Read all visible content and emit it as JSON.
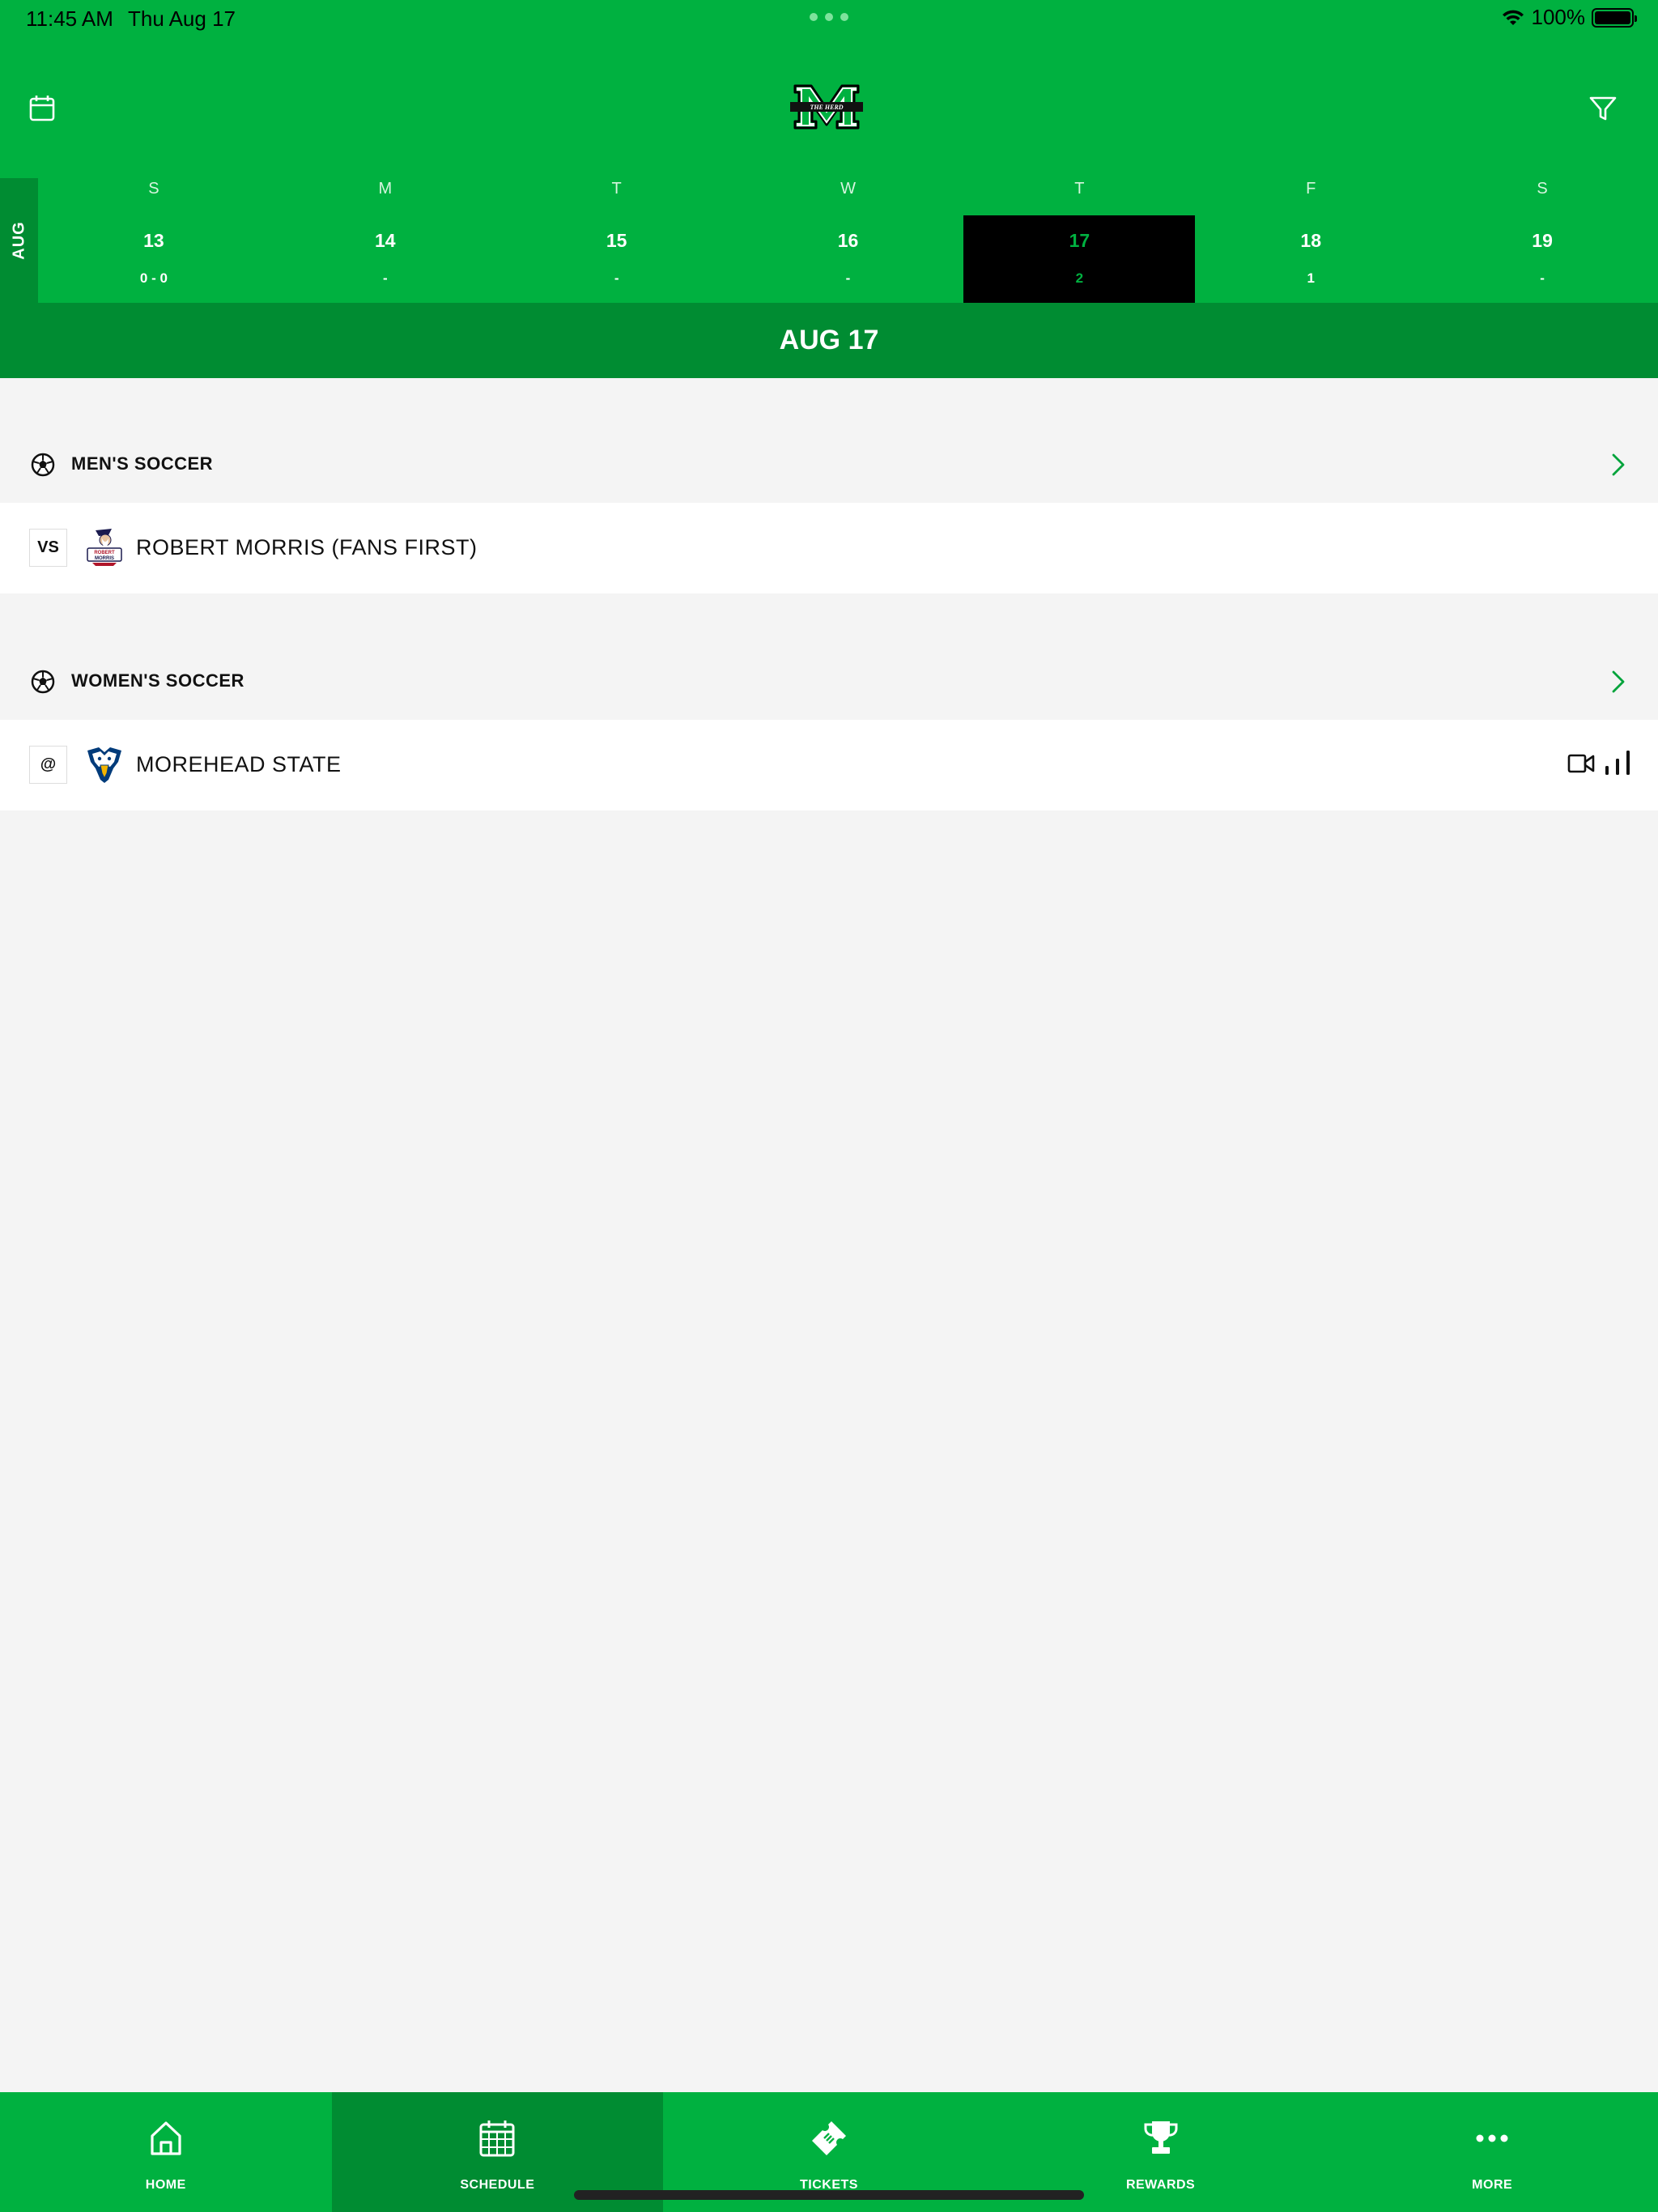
{
  "status_bar": {
    "time": "11:45 AM",
    "date": "Thu Aug 17",
    "battery": "100%"
  },
  "header": {
    "logo_icon": "marshall-thundering-herd-logo",
    "calendar_icon": "calendar-icon",
    "filter_icon": "filter-icon"
  },
  "week": {
    "month": "AUG",
    "days": [
      {
        "dow": "S",
        "num": "13",
        "count": "0 - 0"
      },
      {
        "dow": "M",
        "num": "14",
        "count": "-"
      },
      {
        "dow": "T",
        "num": "15",
        "count": "-"
      },
      {
        "dow": "W",
        "num": "16",
        "count": "-"
      },
      {
        "dow": "T",
        "num": "17",
        "count": "2"
      },
      {
        "dow": "F",
        "num": "18",
        "count": "1"
      },
      {
        "dow": "S",
        "num": "19",
        "count": "-"
      }
    ],
    "selected_index": 4
  },
  "selected_date": "AUG 17",
  "sections": [
    {
      "sport": "MEN'S SOCCER",
      "game": {
        "home_away": "VS",
        "opponent": "ROBERT MORRIS (FANS FIRST)",
        "opponent_logo": "robert-morris-colonials-logo"
      }
    },
    {
      "sport": "WOMEN'S SOCCER",
      "game": {
        "home_away": "@",
        "opponent": "MOREHEAD STATE",
        "opponent_logo": "morehead-state-eagles-logo"
      }
    }
  ],
  "tabs": [
    {
      "label": "HOME",
      "icon": "home-icon"
    },
    {
      "label": "SCHEDULE",
      "icon": "calendar-grid-icon"
    },
    {
      "label": "TICKETS",
      "icon": "ticket-icon"
    },
    {
      "label": "REWARDS",
      "icon": "trophy-icon"
    },
    {
      "label": "MORE",
      "icon": "more-dots-icon"
    }
  ],
  "active_tab": 1,
  "colors": {
    "brand_green": "#00b140",
    "dark_green": "#008c32",
    "background": "#f4f4f4"
  }
}
